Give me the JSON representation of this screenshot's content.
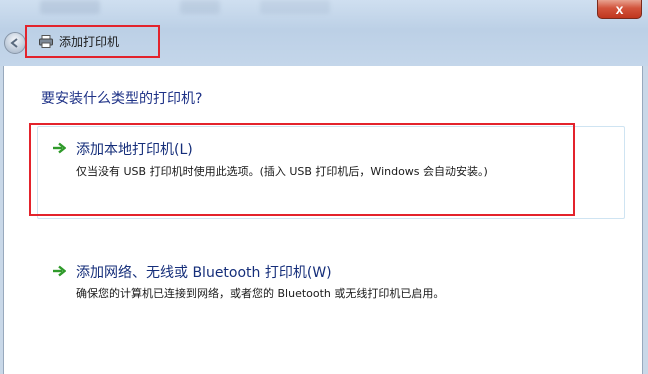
{
  "window": {
    "breadcrumb_title": "添加打印机",
    "close_symbol": "x"
  },
  "main": {
    "question": "要安装什么类型的打印机?",
    "options": [
      {
        "title": "添加本地打印机(L)",
        "description": "仅当没有 USB 打印机时使用此选项。(插入 USB 打印机后，Windows 会自动安装。)"
      },
      {
        "title": "添加网络、无线或 Bluetooth 打印机(W)",
        "description": "确保您的计算机已连接到网络，或者您的 Bluetooth 或无线打印机已启用。"
      }
    ]
  },
  "colors": {
    "highlight_border": "#e3232c",
    "heading_blue": "#1e3287",
    "arrow_green": "#2f9a2a"
  }
}
